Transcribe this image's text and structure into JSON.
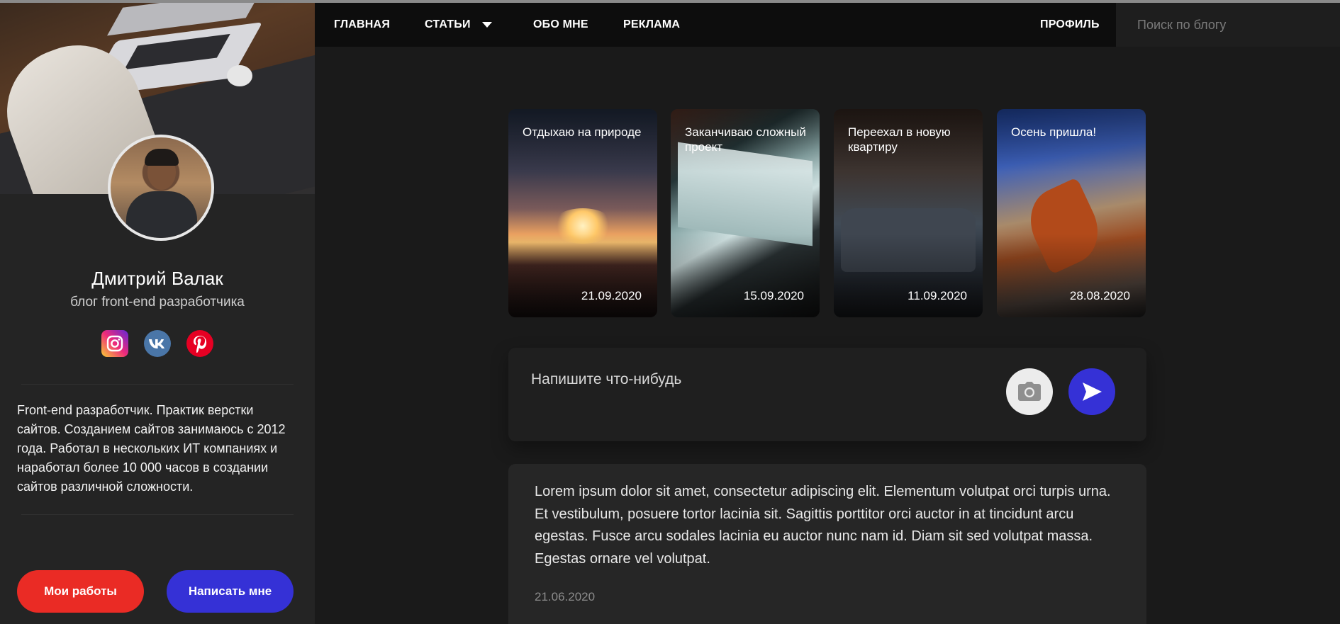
{
  "nav": {
    "home": "ГЛАВНАЯ",
    "articles": "СТАТЬИ",
    "about": "ОБО МНЕ",
    "ads": "РЕКЛАМА",
    "profile": "ПРОФИЛЬ",
    "search_placeholder": "Поиск по блогу"
  },
  "profile": {
    "name": "Дмитрий Валак",
    "subtitle": "блог front-end разработчика",
    "socials": [
      "instagram-icon",
      "vk-icon",
      "pinterest-icon"
    ],
    "about": "Front-end разработчик. Практик верстки сайтов. Созданием сайтов занимаюсь с 2012 года. Работал в нескольких ИТ компаниях и наработал более 10 000 часов в создании сайтов различной сложности.",
    "works_button": "Мои работы",
    "write_button": "Написать мне"
  },
  "stories": [
    {
      "title": "Отдыхаю на природе",
      "date": "21.09.2020"
    },
    {
      "title": "Заканчиваю сложный проект",
      "date": "15.09.2020"
    },
    {
      "title": "Переехал в новую квартиру",
      "date": "11.09.2020"
    },
    {
      "title": "Осень пришла!",
      "date": "28.08.2020"
    }
  ],
  "composer": {
    "placeholder": "Напишите что-нибудь"
  },
  "post": {
    "text": "Lorem ipsum dolor sit amet, consectetur adipiscing elit. Elementum volutpat orci turpis urna. Et vestibulum, posuere tortor lacinia sit. Sagittis porttitor orci auctor in at tincidunt arcu egestas. Fusce arcu sodales lacinia eu auctor nunc nam id. Diam sit sed volutpat massa. Egestas ornare vel volutpat.",
    "date": "21.06.2020"
  },
  "colors": {
    "accent_blue": "#3531d6",
    "accent_red": "#ea2b25",
    "background": "#1a1a1a",
    "sidebar": "#242424",
    "nav": "#0d0d0d"
  }
}
